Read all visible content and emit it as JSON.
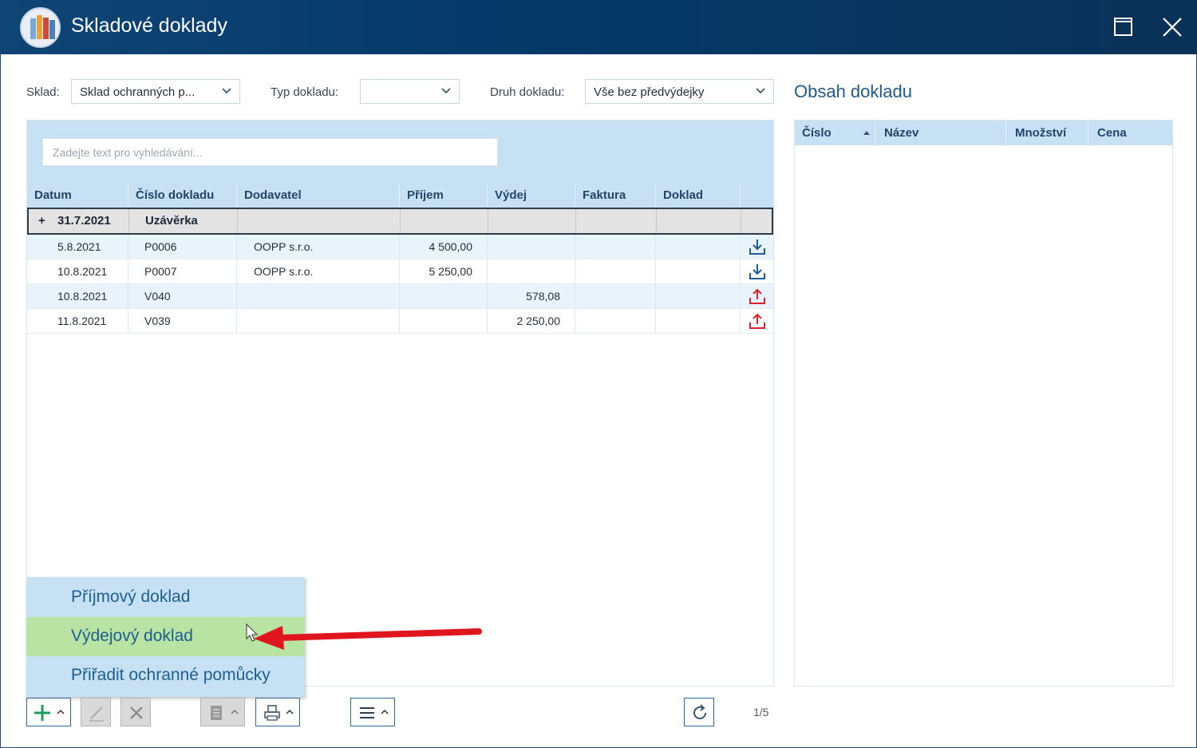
{
  "window": {
    "title": "Skladové doklady"
  },
  "filters": {
    "sklad_label": "Sklad:",
    "sklad_value": "Sklad ochranných p...",
    "typ_label": "Typ dokladu:",
    "typ_value": "",
    "druh_label": "Druh dokladu:",
    "druh_value": "Vše bez předvýdejky"
  },
  "search": {
    "placeholder": "Zadejte text pro vyhledávání..."
  },
  "grid": {
    "columns": [
      "Datum",
      "Číslo dokladu",
      "Dodavatel",
      "Příjem",
      "Výdej",
      "Faktura",
      "Doklad"
    ],
    "group": {
      "toggle": "+",
      "date": "31.7.2021",
      "label": "Uzávěrka"
    },
    "rows": [
      {
        "date": "5.8.2021",
        "number": "P0006",
        "supplier": "OOPP s.r.o.",
        "income": "4 500,00",
        "expense": "",
        "invoice": "",
        "doc": "",
        "icon": "download-icon"
      },
      {
        "date": "10.8.2021",
        "number": "P0007",
        "supplier": "OOPP s.r.o.",
        "income": "5 250,00",
        "expense": "",
        "invoice": "",
        "doc": "",
        "icon": "download-icon"
      },
      {
        "date": "10.8.2021",
        "number": "V040",
        "supplier": "",
        "income": "",
        "expense": "578,08",
        "invoice": "",
        "doc": "",
        "icon": "upload-icon"
      },
      {
        "date": "11.8.2021",
        "number": "V039",
        "supplier": "",
        "income": "",
        "expense": "2 250,00",
        "invoice": "",
        "doc": "",
        "icon": "upload-icon"
      }
    ]
  },
  "content_panel": {
    "title": "Obsah dokladu",
    "columns": [
      "Číslo",
      "Název",
      "Množství",
      "Cena"
    ]
  },
  "popup_menu": {
    "items": [
      "Příjmový doklad",
      "Výdejový doklad",
      "Přiřadit ochranné pomůcky"
    ],
    "highlighted": "Výdejový doklad"
  },
  "footer": {
    "pager": "1/5"
  },
  "colors": {
    "title_bar": "#0a3d6b",
    "grid_header": "#c5e1f3",
    "row_alt": "#e8f3fb",
    "menu_highlight": "#b8e3a2",
    "income_icon": "#1b5d9b",
    "expense_icon": "#d9222a",
    "arrow": "#e0161e"
  }
}
